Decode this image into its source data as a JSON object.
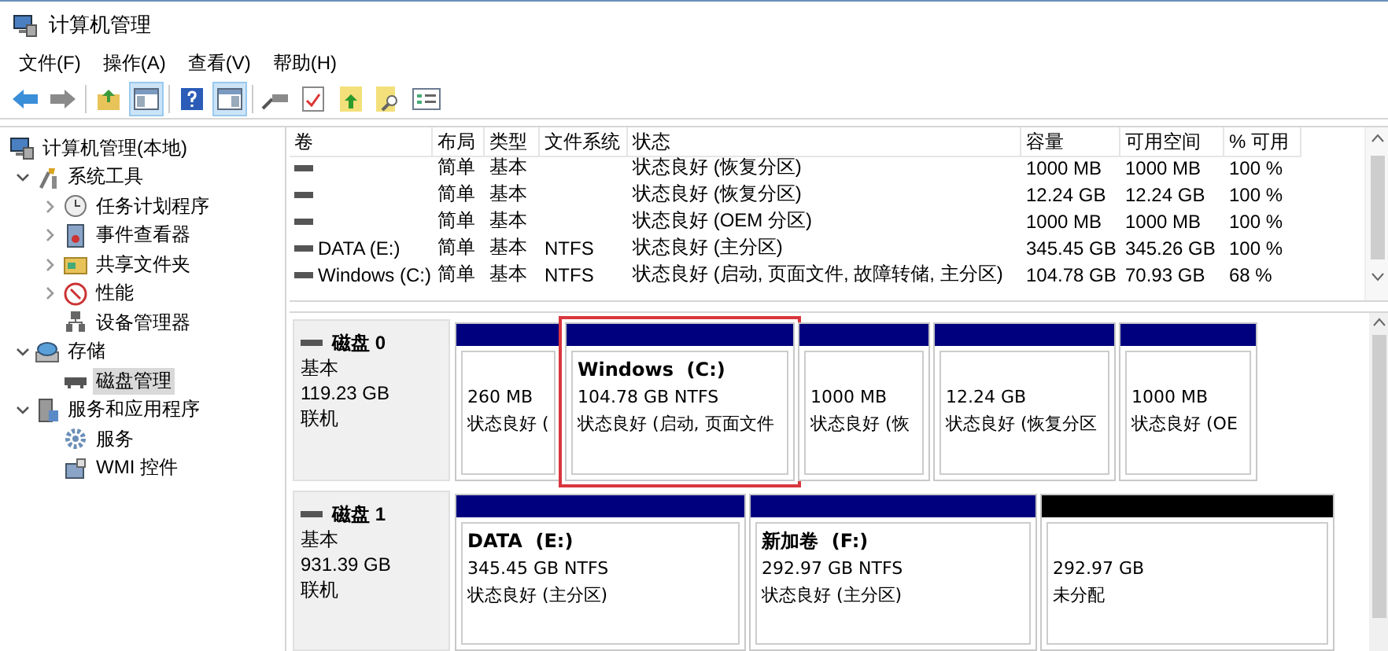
{
  "window": {
    "title": "计算机管理"
  },
  "menu": [
    "文件(F)",
    "操作(A)",
    "查看(V)",
    "帮助(H)"
  ],
  "tree": [
    {
      "label": "计算机管理(本地)",
      "selected": false,
      "children": [
        {
          "label": "系统工具",
          "expanded": true,
          "selected": false,
          "children": [
            {
              "label": "任务计划程序",
              "expanded": false,
              "selected": false
            },
            {
              "label": "事件查看器",
              "expanded": false,
              "selected": false
            },
            {
              "label": "共享文件夹",
              "expanded": false,
              "selected": false
            },
            {
              "label": "性能",
              "expanded": false,
              "selected": false
            },
            {
              "label": "设备管理器",
              "selected": false
            }
          ]
        },
        {
          "label": "存储",
          "expanded": true,
          "selected": false,
          "children": [
            {
              "label": "磁盘管理",
              "selected": true
            }
          ]
        },
        {
          "label": "服务和应用程序",
          "expanded": true,
          "selected": false,
          "children": [
            {
              "label": "服务",
              "selected": false
            },
            {
              "label": "WMI 控件",
              "selected": false
            }
          ]
        }
      ]
    }
  ],
  "table": {
    "columns": [
      "卷",
      "布局",
      "类型",
      "文件系统",
      "状态",
      "容量",
      "可用空间",
      "% 可用"
    ],
    "rows": [
      {
        "layout": "简单",
        "type": "基本",
        "status": "状态良好 (恢复分区)",
        "capacity": "1000 MB",
        "free_space": "1000 MB",
        "percent_free": "100 %"
      },
      {
        "layout": "简单",
        "type": "基本",
        "status": "状态良好 (恢复分区)",
        "capacity": "12.24 GB",
        "free_space": "12.24 GB",
        "percent_free": "100 %"
      },
      {
        "layout": "简单",
        "type": "基本",
        "status": "状态良好 (OEM 分区)",
        "capacity": "1000 MB",
        "free_space": "1000 MB",
        "percent_free": "100 %"
      },
      {
        "volume": "DATA (E:)",
        "layout": "简单",
        "type": "基本",
        "file_system": "NTFS",
        "status": "状态良好 (主分区)",
        "capacity": "345.45 GB",
        "free_space": "345.26 GB",
        "percent_free": "100 %"
      },
      {
        "volume": "Windows (C:)",
        "layout": "简单",
        "type": "基本",
        "file_system": "NTFS",
        "status": "状态良好 (启动, 页面文件, 故障转储, 主分区)",
        "capacity": "104.78 GB",
        "free_space": "70.93 GB",
        "percent_free": "68 %"
      }
    ]
  },
  "disks": [
    {
      "name": "磁盘 0",
      "type": "基本",
      "size": "119.23 GB",
      "status": "联机",
      "partitions": [
        {
          "kind": "primary",
          "highlighted": false,
          "size": "260 MB",
          "status": "状态良好 ("
        },
        {
          "kind": "primary",
          "highlighted": true,
          "label": "Windows  (C:)",
          "size": "104.78 GB NTFS",
          "status": "状态良好 (启动, 页面文件"
        },
        {
          "kind": "primary",
          "highlighted": false,
          "size": "1000 MB",
          "status": "状态良好 (恢"
        },
        {
          "kind": "primary",
          "highlighted": false,
          "size": "12.24 GB",
          "status": "状态良好 (恢复分区"
        },
        {
          "kind": "primary",
          "highlighted": false,
          "size": "1000 MB",
          "status": "状态良好 (OE"
        }
      ]
    },
    {
      "name": "磁盘 1",
      "type": "基本",
      "size": "931.39 GB",
      "status": "联机",
      "partitions": [
        {
          "kind": "primary",
          "highlighted": false,
          "label": "DATA  (E:)",
          "size": "345.45 GB NTFS",
          "status": "状态良好 (主分区)"
        },
        {
          "kind": "primary",
          "highlighted": false,
          "label": "新加卷  (F:)",
          "size": "292.97 GB NTFS",
          "status": "状态良好 (主分区)"
        },
        {
          "kind": "unallocated",
          "highlighted": false,
          "size": "292.97 GB",
          "status": "未分配"
        }
      ]
    }
  ]
}
